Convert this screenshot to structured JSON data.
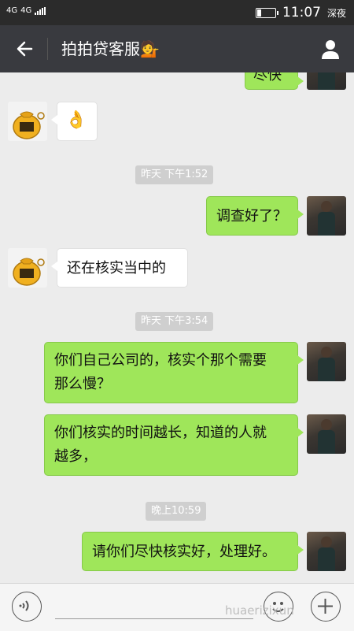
{
  "status_bar": {
    "network_top": "4G",
    "network_main": "4G",
    "time": "11:07",
    "mode": "深夜"
  },
  "header": {
    "title": "拍拍贷客服💁"
  },
  "messages": [
    {
      "side": "right",
      "text": "尽快",
      "partial": true
    },
    {
      "side": "left",
      "text": "👌"
    },
    {
      "type": "time",
      "text": "昨天 下午1:52"
    },
    {
      "side": "right",
      "text": "调查好了？"
    },
    {
      "side": "left",
      "text": "还在核实当中的"
    },
    {
      "type": "time",
      "text": "昨天 下午3:54"
    },
    {
      "side": "right",
      "lines": [
        "你们自己公司的，核实个那个需要",
        "那么慢？"
      ]
    },
    {
      "side": "right",
      "lines": [
        "你们核实的时间越长，知道的人就",
        "越多，"
      ]
    },
    {
      "type": "time",
      "text": "晚上10:59"
    },
    {
      "side": "right",
      "text": "请你们尽快核实好，处理好。"
    }
  ],
  "watermark": "huaerizixun",
  "colors": {
    "header_bg": "#393a3f",
    "chat_bg": "#ececec",
    "bubble_green": "#9fe65a",
    "bubble_white": "#ffffff",
    "time_badge": "#cfcfcf"
  },
  "icons": {
    "back": "back-arrow-icon",
    "profile": "person-icon",
    "voice": "voice-icon",
    "emoji": "emoji-icon",
    "plus": "plus-icon"
  }
}
